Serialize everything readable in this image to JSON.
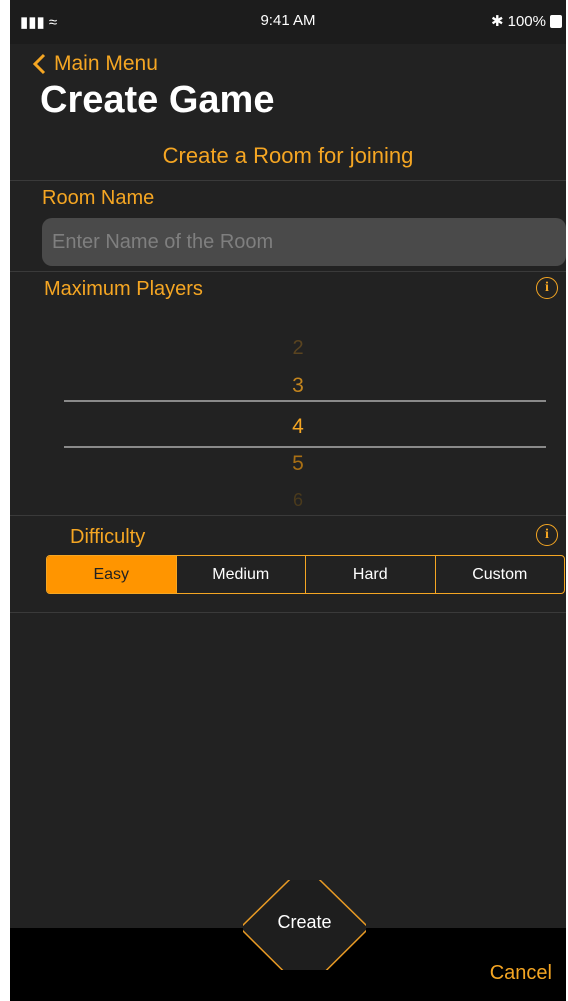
{
  "status": {
    "time": "9:41 AM",
    "battery": "100%"
  },
  "nav": {
    "back_label": "Main Menu",
    "title": "Create Game"
  },
  "subtitle": "Create a Room for joining",
  "room": {
    "label": "Room Name",
    "placeholder": "Enter Name of the Room"
  },
  "players": {
    "label": "Maximum Players",
    "options": [
      "2",
      "3",
      "4",
      "5",
      "6"
    ],
    "selected": "4"
  },
  "difficulty": {
    "label": "Difficulty",
    "options": [
      "Easy",
      "Medium",
      "Hard",
      "Custom"
    ],
    "selected": "Easy"
  },
  "actions": {
    "create": "Create",
    "cancel": "Cancel"
  },
  "colors": {
    "accent": "#f5a623",
    "background": "#222222",
    "selected_segment": "#ff9500"
  }
}
